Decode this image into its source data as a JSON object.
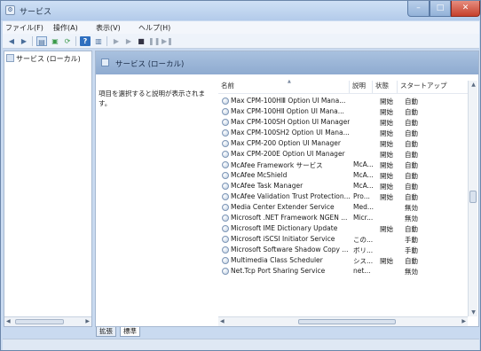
{
  "window": {
    "title": "サービス"
  },
  "menu": [
    "ファイル(F)",
    "操作(A)",
    "表示(V)",
    "ヘルプ(H)"
  ],
  "toolbar": {
    "icons": [
      "back-arrow-icon",
      "forward-arrow-icon",
      "console-tree-icon",
      "properties-icon",
      "refresh-icon",
      "help-icon",
      "show-hide-icon",
      "start-service-icon",
      "start-service-icon-2",
      "stop-service-icon",
      "pause-service-icon",
      "restart-service-icon"
    ]
  },
  "left_pane": {
    "tree_item": "サービス (ローカル)"
  },
  "right_pane": {
    "header": "サービス (ローカル)",
    "description": "項目を選択すると説明が表示されます。",
    "columns": {
      "name": "名前",
      "desc": "説明",
      "state": "状態",
      "start": "スタートアップ"
    },
    "rows": [
      {
        "name": "Max CPM-100HⅢ Option UI Mana...",
        "desc": "",
        "state": "開始",
        "start": "自動"
      },
      {
        "name": "Max CPM-100HⅡ Option UI Mana...",
        "desc": "",
        "state": "開始",
        "start": "自動"
      },
      {
        "name": "Max CPM-100SH Option UI Manager",
        "desc": "",
        "state": "開始",
        "start": "自動"
      },
      {
        "name": "Max CPM-100SH2 Option UI Mana...",
        "desc": "",
        "state": "開始",
        "start": "自動"
      },
      {
        "name": "Max CPM-200 Option UI Manager",
        "desc": "",
        "state": "開始",
        "start": "自動"
      },
      {
        "name": "Max CPM-200E Option UI Manager",
        "desc": "",
        "state": "開始",
        "start": "自動"
      },
      {
        "name": "McAfee Framework サービス",
        "desc": "McA...",
        "state": "開始",
        "start": "自動"
      },
      {
        "name": "McAfee McShield",
        "desc": "McA...",
        "state": "開始",
        "start": "自動"
      },
      {
        "name": "McAfee Task Manager",
        "desc": "McA...",
        "state": "開始",
        "start": "自動"
      },
      {
        "name": "McAfee Validation Trust Protection...",
        "desc": "Pro...",
        "state": "開始",
        "start": "自動"
      },
      {
        "name": "Media Center Extender Service",
        "desc": "Med...",
        "state": "",
        "start": "無効"
      },
      {
        "name": "Microsoft .NET Framework NGEN ...",
        "desc": "Micr...",
        "state": "",
        "start": "無効"
      },
      {
        "name": "Microsoft IME Dictionary Update",
        "desc": "",
        "state": "開始",
        "start": "自動"
      },
      {
        "name": "Microsoft iSCSI Initiator Service",
        "desc": "この...",
        "state": "",
        "start": "手動"
      },
      {
        "name": "Microsoft Software Shadow Copy ...",
        "desc": "ボリ...",
        "state": "",
        "start": "手動"
      },
      {
        "name": "Multimedia Class Scheduler",
        "desc": "シス...",
        "state": "開始",
        "start": "自動"
      },
      {
        "name": "Net.Tcp Port Sharing Service",
        "desc": "net...",
        "state": "",
        "start": "無効"
      }
    ]
  },
  "tabs": [
    "拡張",
    "標準"
  ]
}
